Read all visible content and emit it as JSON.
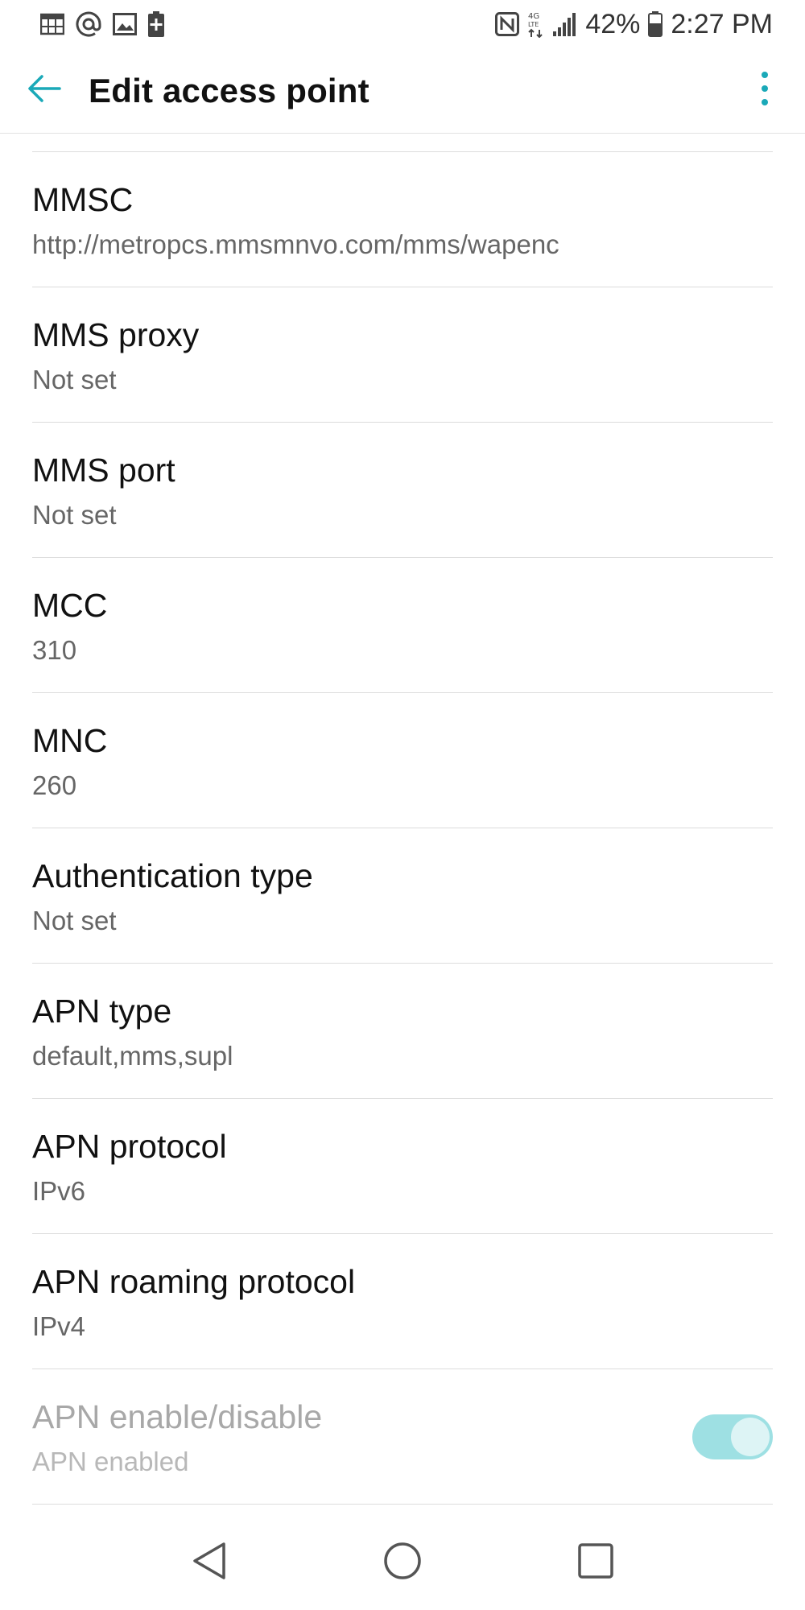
{
  "status_bar": {
    "left_icons": [
      "calendar-icon",
      "at-sign-icon",
      "image-icon",
      "battery-saver-icon"
    ],
    "right_icons": [
      "nfc-icon",
      "lte-data-icon",
      "signal-icon"
    ],
    "battery_percent": "42%",
    "time": "2:27 PM"
  },
  "app_bar": {
    "title": "Edit access point",
    "back_icon": "arrow-back-icon",
    "overflow_icon": "more-vert-icon"
  },
  "items": [
    {
      "title": "MMSC",
      "summary": "http://metropcs.mmsmnvo.com/mms/wapenc"
    },
    {
      "title": "MMS proxy",
      "summary": "Not set"
    },
    {
      "title": "MMS port",
      "summary": "Not set"
    },
    {
      "title": "MCC",
      "summary": "310"
    },
    {
      "title": "MNC",
      "summary": "260"
    },
    {
      "title": "Authentication type",
      "summary": "Not set"
    },
    {
      "title": "APN type",
      "summary": "default,mms,supl"
    },
    {
      "title": "APN protocol",
      "summary": "IPv6"
    },
    {
      "title": "APN roaming protocol",
      "summary": "IPv4"
    },
    {
      "title": "APN enable/disable",
      "summary": "APN enabled",
      "toggle_on": true
    }
  ],
  "colors": {
    "accent": "#1aa9b8",
    "toggle_track": "#9ee0e3",
    "toggle_knob": "#ddf4f5"
  },
  "nav_bar": {
    "icons": [
      "nav-back-icon",
      "nav-home-icon",
      "nav-recents-icon"
    ]
  }
}
